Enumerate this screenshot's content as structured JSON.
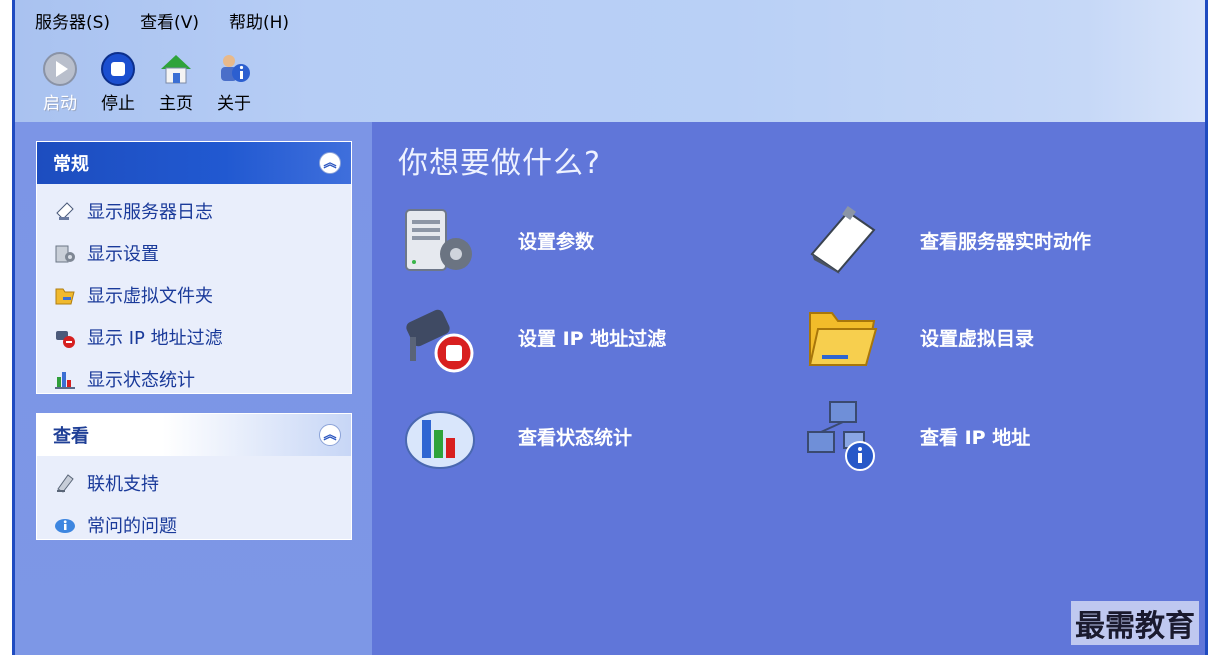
{
  "menu": [
    "服务器(S)",
    "查看(V)",
    "帮助(H)"
  ],
  "toolbar": {
    "start": "启动",
    "stop": "停止",
    "home": "主页",
    "about": "关于"
  },
  "groups": {
    "general": {
      "title": "常规",
      "items": [
        "显示服务器日志",
        "显示设置",
        "显示虚拟文件夹",
        "显示 IP 地址过滤",
        "显示状态统计"
      ]
    },
    "view": {
      "title": "查看",
      "items": [
        "联机支持",
        "常问的问题"
      ]
    }
  },
  "main": {
    "title": "你想要做什么?",
    "tasks": [
      "设置参数",
      "查看服务器实时动作",
      "设置 IP 地址过滤",
      "设置虚拟目录",
      "查看状态统计",
      "查看 IP 地址"
    ]
  },
  "watermark": "最需教育",
  "colors": {
    "pane_blue": "#6076d9",
    "header_blue": "#1d4dbf",
    "link_text": "#1a3a9a"
  }
}
